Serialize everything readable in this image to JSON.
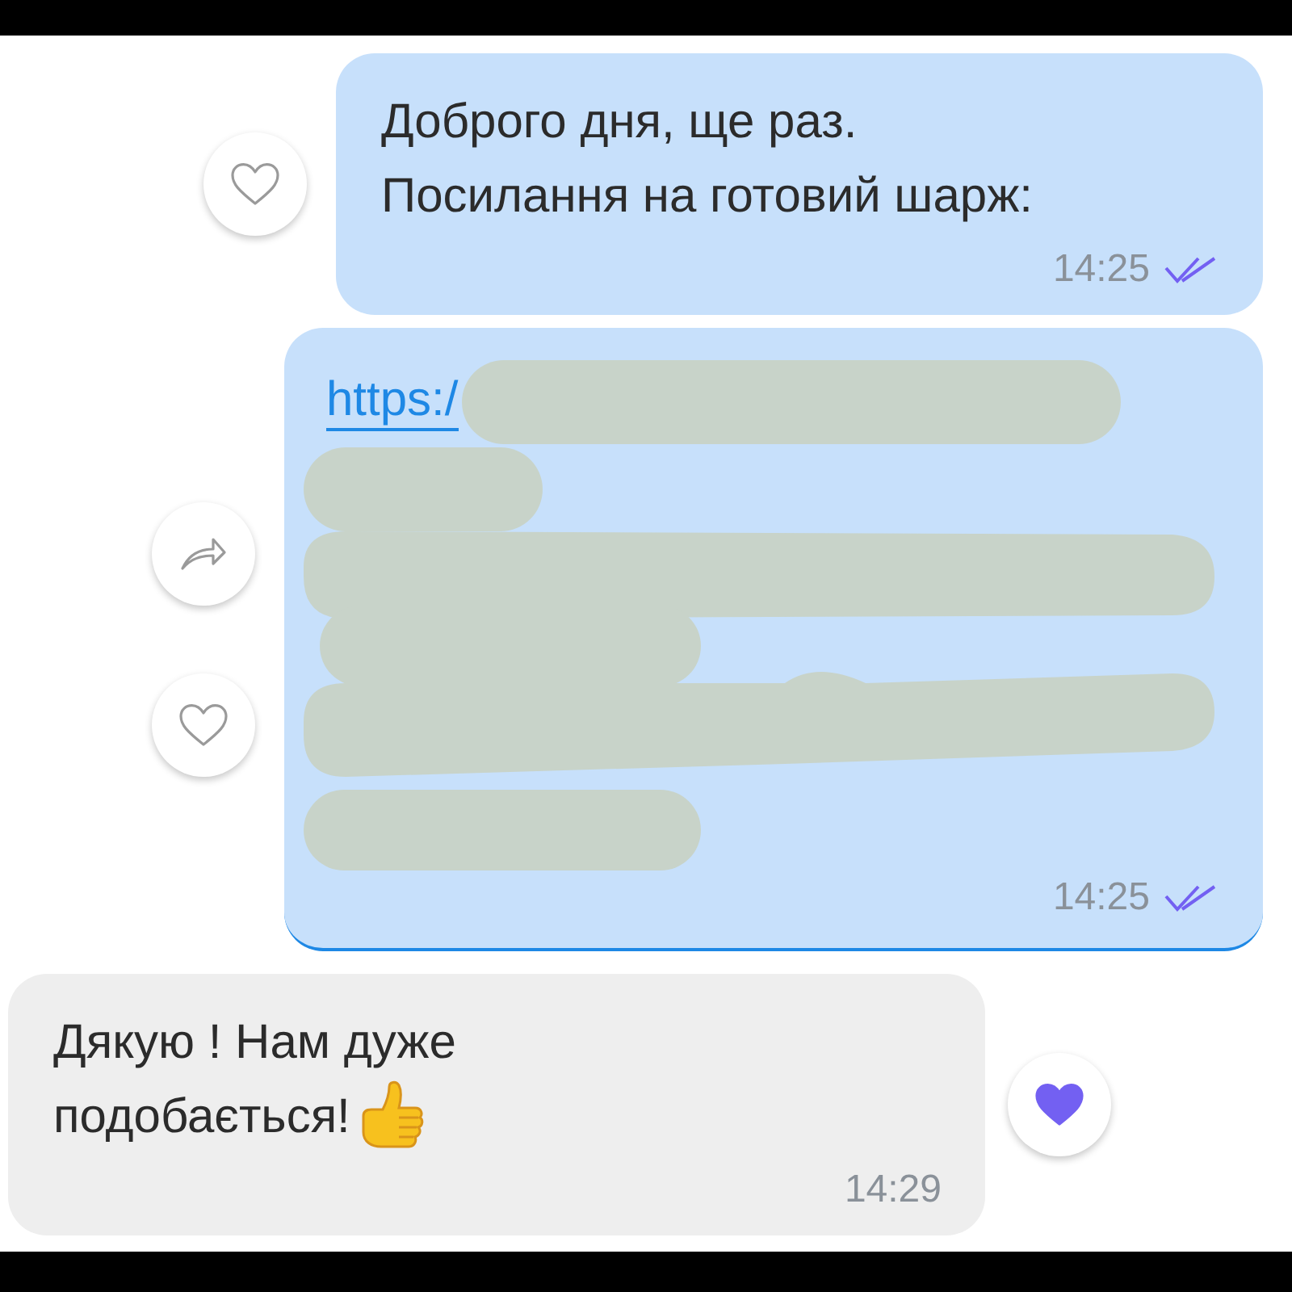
{
  "messages": [
    {
      "kind": "text",
      "outgoing": true,
      "lines": [
        "Доброго дня, ще раз.",
        "Посилання на готовий шарж:"
      ],
      "time": "14:25",
      "read": true,
      "actions": [
        {
          "kind": "like",
          "selected": false
        }
      ]
    },
    {
      "kind": "link",
      "outgoing": true,
      "link": "https:/",
      "redacted": true,
      "time": "14:25",
      "read": true,
      "actions": [
        {
          "kind": "forward"
        },
        {
          "kind": "like",
          "selected": false
        }
      ]
    },
    {
      "kind": "text",
      "outgoing": false,
      "lines": [
        "Дякую ! Нам дуже",
        "подобається!"
      ],
      "thumbs_up": true,
      "time": "14:29",
      "actions": [
        {
          "kind": "like",
          "selected": true
        }
      ]
    }
  ]
}
